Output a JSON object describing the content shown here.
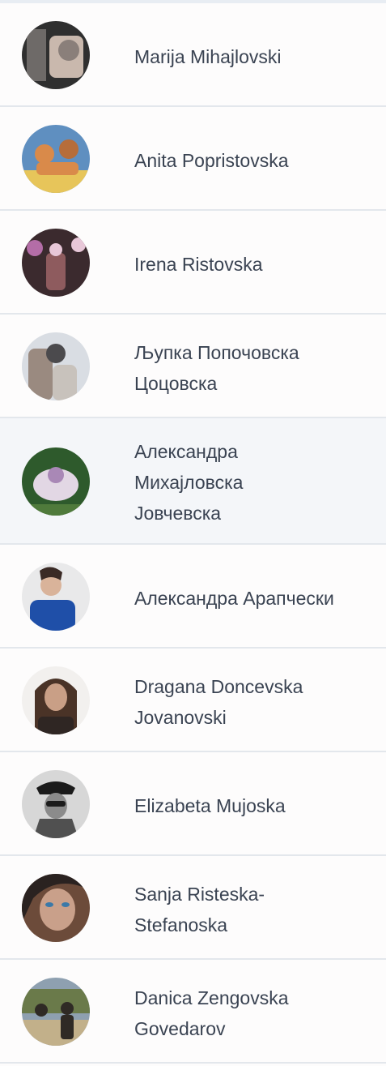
{
  "friends": [
    {
      "line1": "Marija Mihajlovski",
      "line2": "",
      "line3": "",
      "avatar": "photo-avatar",
      "colors": [
        "#2f2f2f",
        "#6e6a68",
        "#c9b8ad",
        "#8a7f7a"
      ]
    },
    {
      "line1": "Anita Popristovska",
      "line2": "",
      "line3": "",
      "avatar": "photo-avatar",
      "colors": [
        "#5f8fc0",
        "#d98a4a",
        "#e7c55a",
        "#b66d3a"
      ]
    },
    {
      "line1": "Irena Ristovska",
      "line2": "",
      "line3": "",
      "avatar": "photo-avatar",
      "colors": [
        "#3b2a2e",
        "#b46da7",
        "#8e5b5e",
        "#e8c7d8"
      ]
    },
    {
      "line1": "Љупка Попочовска",
      "line2": "Цоцовска",
      "line3": "",
      "avatar": "photo-avatar",
      "colors": [
        "#d9dde3",
        "#9a8a80",
        "#4b4a4d",
        "#c8c2bc"
      ]
    },
    {
      "line1": "Александра",
      "line2": "Михајловска",
      "line3": "Јовчевска",
      "avatar": "photo-avatar",
      "colors": [
        "#2e5a2c",
        "#e2d7e4",
        "#a988b6",
        "#4f7a3b"
      ]
    },
    {
      "line1": "Александра Арапчески",
      "line2": "",
      "line3": "",
      "avatar": "photo-avatar",
      "colors": [
        "#e9e9ea",
        "#1f4fa8",
        "#d9b39a",
        "#3a2a25"
      ]
    },
    {
      "line1": "Dragana Doncevska",
      "line2": "Jovanovski",
      "line3": "",
      "avatar": "photo-avatar",
      "colors": [
        "#f2f0ee",
        "#4a3327",
        "#c99f86",
        "#2f2623"
      ]
    },
    {
      "line1": "Elizabeta Mujoska",
      "line2": "",
      "line3": "",
      "avatar": "photo-avatar",
      "colors": [
        "#d7d7d7",
        "#1b1b1b",
        "#8b8b8b",
        "#505050"
      ]
    },
    {
      "line1": "Sanja Risteska-",
      "line2": "Stefanoska",
      "line3": "",
      "avatar": "photo-avatar",
      "colors": [
        "#6c4b3a",
        "#3a79a8",
        "#c9a08a",
        "#2a2220"
      ]
    },
    {
      "line1": "Danica Zengovska",
      "line2": "Govedarov",
      "line3": "",
      "avatar": "photo-avatar",
      "colors": [
        "#6a7a4a",
        "#c2b08a",
        "#2f2a25",
        "#8ea0b0"
      ]
    }
  ]
}
